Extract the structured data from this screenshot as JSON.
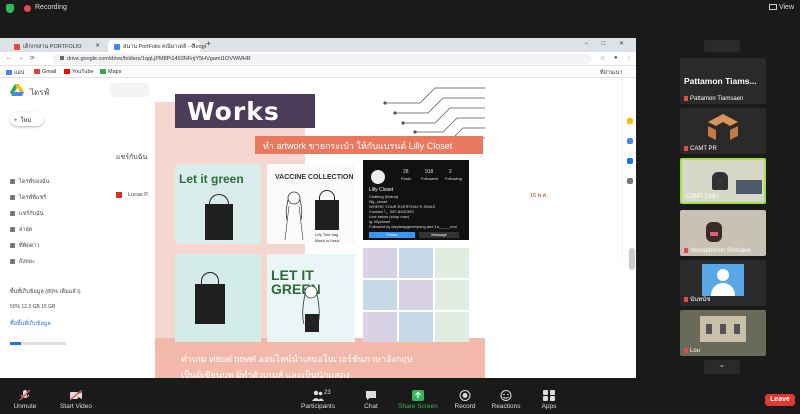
{
  "zoom": {
    "recording_label": "Recording",
    "view_label": "View"
  },
  "browser": {
    "tabs": [
      {
        "label": "เด็กกรสาน PORTFOLIO"
      },
      {
        "label": "สนาน PortFolio คณิษาเตลิ - Googl"
      }
    ],
    "new_tab_symbol": "+",
    "window_controls": "− □ ✕",
    "url": "drive.google.com/drive/folders/1qqLjPM8Pi1493NFnjY5HVgamI1OVWMHR",
    "bookmarks": [
      "แอป",
      "Gmail",
      "YouTube",
      "Maps"
    ],
    "bookmarks_right": "ที่อ่านเนา"
  },
  "drive": {
    "title": "ไดรฟ์",
    "new_label": "ใหม่",
    "folder_crumb": "แชร์กับฉัน",
    "sidebar": [
      "ไดรฟ์ของฉัน",
      "ไดรฟ์ที่แชร์",
      "แชร์กับฉัน",
      "ล่าสุด",
      "ที่ติดดาว",
      "ถังขยะ"
    ],
    "storage_label": "พื้นที่เก็บข้อมูล (80% เต็มแล้ว)",
    "storage_used": "50% 12.3 GB 15 GB",
    "buy_storage": "ซื้อพื้นที่เก็บข้อมูล",
    "row_label": "Lucas P.",
    "row_date": "15 พ.ค."
  },
  "slide": {
    "works_title": "Works",
    "slogan": "ทำ artwork ขายกระเป๋า ให้กับแบรนด์ Lilly Closet",
    "bag1_title": "Let it green",
    "bag2_title": "VACCINE COLLECTION",
    "bag2_sub": "Lilly Tote bag",
    "bag2_sub2": "Black to basic",
    "bag4_title": "LET IT GREEN",
    "insta_name": "Lilly Closet",
    "insta_posts": "28",
    "insta_followers": "918",
    "insta_following": "2",
    "insta_posts_label": "Posts",
    "insta_followers_label": "Followers",
    "insta_following_label": "Following",
    "insta_bio": [
      "Clothing (Brand)",
      "lilly_closet",
      "WHERE YOUR EVERYDAY'S SMILE",
      "Contact 📞 087-8452393",
      "Line below (shop now)",
      "ig: lillycloset",
      "Followed by lazyistaygreenyang and 1a_____mal"
    ],
    "insta_follow": "Follow",
    "insta_message": "Message",
    "bottom_line1": "ทำเกม visual novel ออนไลน์นำเสนอในเวอร์ชันภาษาอังกฤษ",
    "bottom_line2": "เป็นผู้เขียนบท ผู้ทำตัวเกมส์ และเป็นนักแสดง"
  },
  "participants": [
    {
      "name": "Pattamon Tiamsaen",
      "big": "Pattamon  Tiams..."
    },
    {
      "name": "CAMT PR"
    },
    {
      "name": "CAMT CMU"
    },
    {
      "name": "Veeraphimon Srimalee"
    },
    {
      "name": "นันทนัช"
    },
    {
      "name": "Lou"
    }
  ],
  "toolbar": {
    "unmute": "Unmute",
    "start_video": "Start Video",
    "participants": "Participants",
    "participants_count": "23",
    "chat": "Chat",
    "share_screen": "Share Screen",
    "record": "Record",
    "reactions": "Reactions",
    "apps": "Apps",
    "leave": "Leave"
  },
  "colors": {
    "share_green": "#2fbb5a",
    "leave_red": "#e0392f",
    "works_purple": "#4b3d5a",
    "slogan_orange": "#e8785e",
    "active_border": "#a6e23a"
  }
}
